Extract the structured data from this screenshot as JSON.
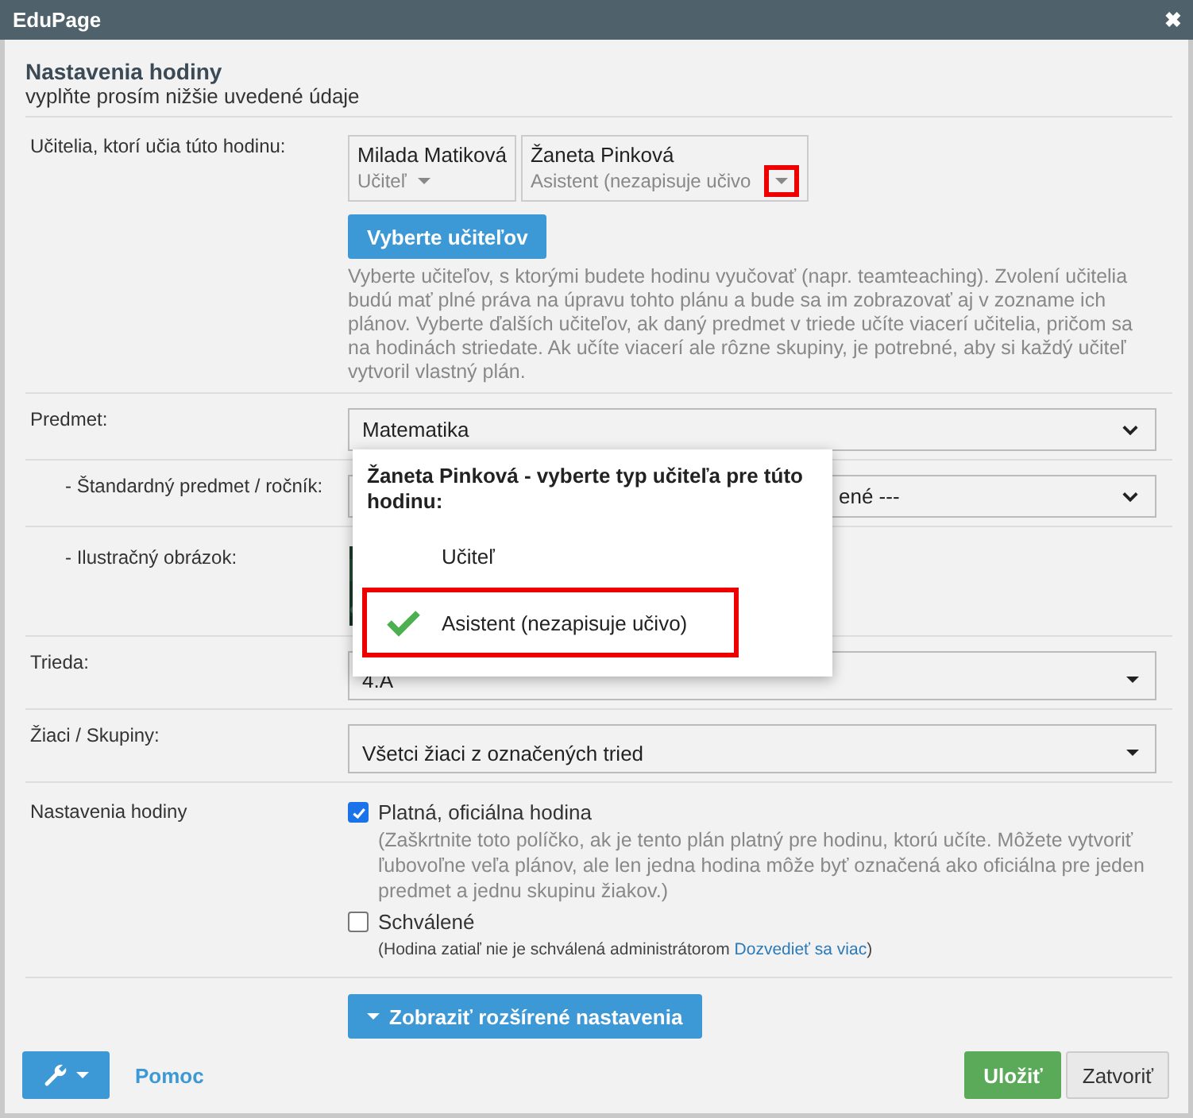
{
  "window": {
    "title": "EduPage",
    "close": "✖"
  },
  "header": {
    "title": "Nastavenia hodiny",
    "subtitle": "vyplňte prosím nižšie uvedené údaje"
  },
  "teachers": {
    "label": "Učitelia, ktorí učia túto hodinu:",
    "items": [
      {
        "name": "Milada Matiková",
        "role": "Učiteľ",
        "highlighted": false
      },
      {
        "name": "Žaneta Pinková",
        "role": "Asistent (nezapisuje učivo",
        "highlighted": true
      }
    ],
    "button": "Vyberte učiteľov",
    "help": "Vyberte učiteľov, s ktorými budete hodinu vyučovať (napr. teamteaching). Zvolení učitelia budú mať plné práva na úpravu tohto plánu a bude sa im zobrazovať aj v zozname ich plánov. Vyberte ďalších učiteľov, ak daný predmet v triede učíte viacerí učitelia, pričom sa na hodinách striedate. Ak učíte viacerí ale rôzne skupiny, je potrebné, aby si každý učiteľ vytvoril vlastný plán."
  },
  "fields": [
    {
      "kind": "chevron_select",
      "label": "Predmet:",
      "value": "Matematika",
      "covered": false,
      "children": [
        {
          "kind": "chevron_select",
          "label": "- Štandardný predmet / ročník:",
          "value": "ené ---",
          "covered": true
        },
        {
          "kind": "picture",
          "label": "- Ilustračný obrázok:"
        }
      ]
    },
    {
      "kind": "caret_select",
      "label": "Trieda:",
      "value": "4.A",
      "covered": false
    },
    {
      "kind": "caret_select",
      "label": "Žiaci / Skupiny:",
      "value": "Všetci žiaci z označených tried",
      "covered": false
    }
  ],
  "lesson_settings": {
    "label": "Nastavenia hodiny",
    "options": [
      {
        "label": "Platná, oficiálna hodina",
        "checked": true,
        "note": "(Zaškrtnite toto políčko, ak je tento plán platný pre hodinu, ktorú učíte. Môžete vytvoriť ľubovoľne veľa plánov, ale len jedna hodina môže byť označená ako oficiálna pre jeden predmet a jednu skupinu žiakov.)"
      },
      {
        "label": "Schválené",
        "checked": false,
        "note": "(Hodina zatiaľ nie je schválená administrátorom ",
        "link": "Dozvedieť sa viac",
        "note_end": ")"
      }
    ]
  },
  "advanced_button": "Zobraziť rozšírené nastavenia",
  "footer": {
    "help_link": "Pomoc",
    "save": "Uložiť",
    "close": "Zatvoriť"
  },
  "popup": {
    "title": "Žaneta Pinková - vyberte typ učiteľa pre túto hodinu:",
    "options": [
      {
        "label": "Učiteľ",
        "selected": false
      },
      {
        "label": "Asistent (nezapisuje učivo)",
        "selected": true
      }
    ]
  }
}
